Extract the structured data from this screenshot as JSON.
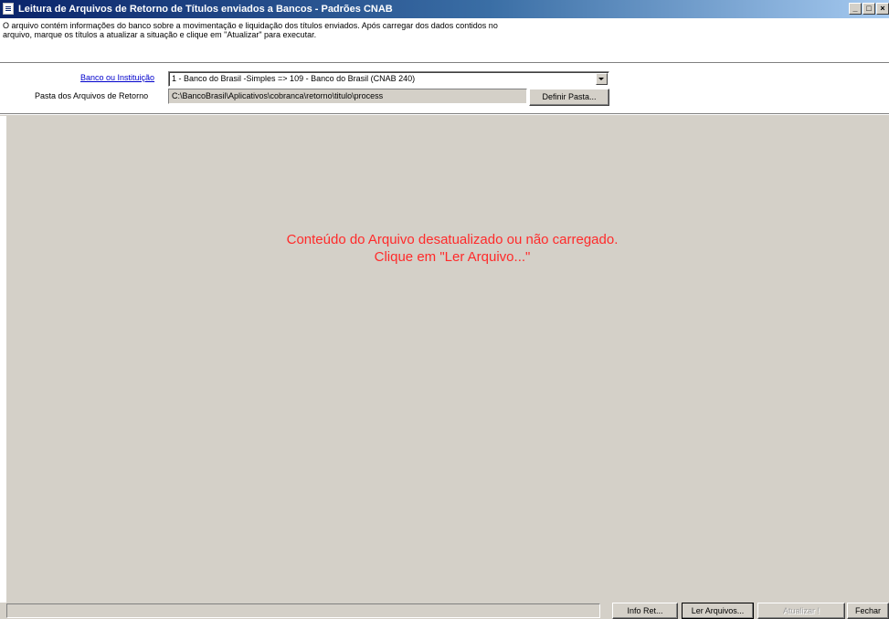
{
  "window": {
    "title": "Leitura de Arquivos de Retorno de Títulos enviados a Bancos - Padrões CNAB",
    "controls": {
      "minimize": "_",
      "maximize": "□",
      "close": "×"
    }
  },
  "description": {
    "line1": "O arquivo contém informações do banco sobre a movimentação e liquidação dos títulos enviados. Após carregar dos dados contidos no",
    "line2": "arquivo, marque os títulos a atualizar a situação e clique em \"Atualizar\" para executar."
  },
  "form": {
    "bank_label": "Banco ou Instituição",
    "bank_value": "1 - Banco do Brasil -Simples => 109 - Banco do Brasil (CNAB 240)",
    "folder_label": "Pasta dos Arquivos de Retorno",
    "folder_value": "C:\\BancoBrasil\\Aplicativos\\cobranca\\retorno\\titulo\\process",
    "define_folder_button": "Definir Pasta..."
  },
  "content": {
    "message_line1": "Conteúdo do Arquivo desatualizado ou não carregado.",
    "message_line2": "Clique em \"Ler Arquivo...\""
  },
  "footer": {
    "info_button": "Info Ret...",
    "read_button": "Ler Arquivos...",
    "update_button": "Atualizar !",
    "close_button": "Fechar"
  },
  "colors": {
    "title_bar": "#0a246a",
    "message": "#ff2a2a",
    "link": "#0000cc",
    "face": "#d4d0c8"
  }
}
